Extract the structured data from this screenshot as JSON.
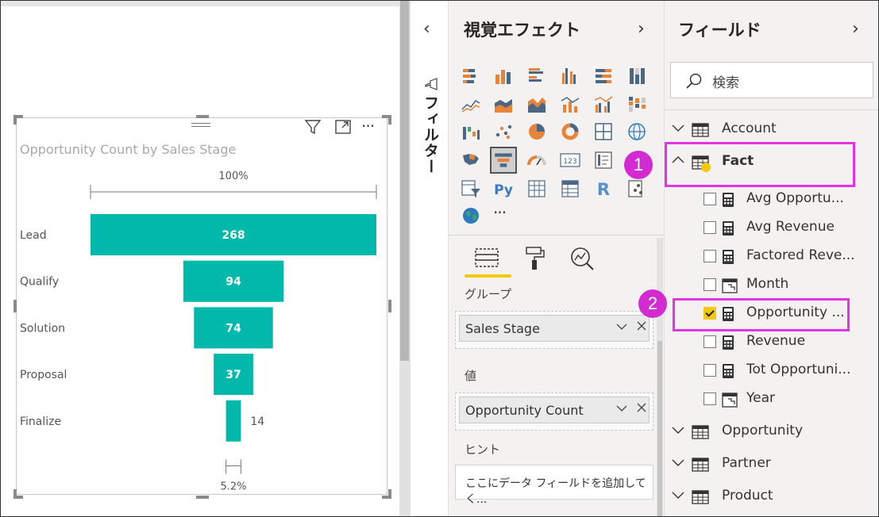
{
  "colors": {
    "accent": "#f2c811",
    "funnel": "#01b8aa",
    "highlight": "#e632e6"
  },
  "canvas": {
    "visual": {
      "header_icons": [
        "filter-icon",
        "focus-mode-icon",
        "more-options-icon"
      ],
      "more_glyph": "···"
    }
  },
  "chart_data": {
    "type": "funnel",
    "title": "Opportunity Count by Sales Stage",
    "categories": [
      "Lead",
      "Qualify",
      "Solution",
      "Proposal",
      "Finalize"
    ],
    "values": [
      268,
      94,
      74,
      37,
      14
    ],
    "top_percent_label": "100%",
    "bottom_percent_label": "5.2%"
  },
  "filter_pane": {
    "label": "フィルター",
    "collapse_glyph": "‹"
  },
  "viz_pane": {
    "title": "視覚エフェクト",
    "expand_glyph": "›",
    "more_glyph": "···",
    "sections": {
      "group_label": "グループ",
      "group_value": "Sales Stage",
      "values_label": "値",
      "values_value": "Opportunity Count",
      "tooltips_label": "ヒント",
      "tooltips_placeholder": "ここにデータ フィールドを追加してく..."
    },
    "py_label": "Py",
    "r_label": "R",
    "card_label": "123"
  },
  "fields_pane": {
    "title": "フィールド",
    "expand_glyph": "›",
    "search_placeholder": "検索",
    "tables": [
      {
        "name": "Account",
        "expanded": false
      },
      {
        "name": "Fact",
        "expanded": true
      },
      {
        "name": "Opportunity",
        "expanded": false
      },
      {
        "name": "Partner",
        "expanded": false
      },
      {
        "name": "Product",
        "expanded": false
      }
    ],
    "fact_fields": [
      {
        "name": "Avg Opportu...",
        "checked": false,
        "icon": "calculator-icon"
      },
      {
        "name": "Avg Revenue",
        "checked": false,
        "icon": "calculator-icon"
      },
      {
        "name": "Factored Reve...",
        "checked": false,
        "icon": "calculator-icon"
      },
      {
        "name": "Month",
        "checked": false,
        "icon": "calendar-hierarchy-icon"
      },
      {
        "name": "Opportunity ...",
        "checked": true,
        "icon": "calculator-icon"
      },
      {
        "name": "Revenue",
        "checked": false,
        "icon": "calculator-icon"
      },
      {
        "name": "Tot Opportuni...",
        "checked": false,
        "icon": "calculator-icon"
      },
      {
        "name": "Year",
        "checked": false,
        "icon": "calendar-hierarchy-icon"
      }
    ]
  },
  "annotations": {
    "badge_1": "1",
    "badge_2": "2"
  }
}
